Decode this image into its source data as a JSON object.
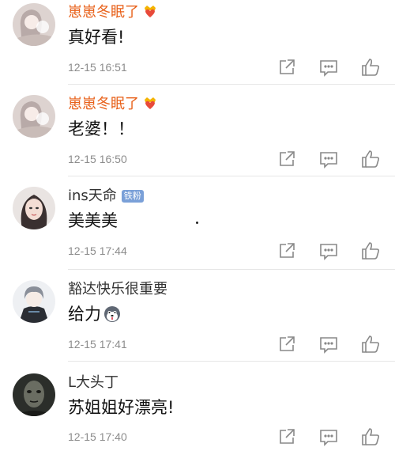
{
  "comments": [
    {
      "username": "崽崽冬眠了",
      "text": "真好看!",
      "time": "12-15 16:51",
      "badge": "crown-heart-icon",
      "avatar": "girl-sticker-avatar"
    },
    {
      "username": "崽崽冬眠了",
      "text": "老婆！！",
      "time": "12-15 16:50",
      "badge": "crown-heart-icon",
      "avatar": "girl-sticker-avatar"
    },
    {
      "username": "ins天命",
      "fan_badge": "铁粉",
      "text": "美美美",
      "time": "12-15 17:44",
      "avatar": "woman-portrait-avatar"
    },
    {
      "username": "豁达快乐很重要",
      "text": "给力",
      "emoji": "husky-dog-emoji",
      "time": "12-15 17:41",
      "avatar": "anime-boy-avatar"
    },
    {
      "username": "L大头丁",
      "text": "苏姐姐好漂亮!",
      "time": "12-15 17:40",
      "avatar": "dark-face-avatar"
    }
  ],
  "actions": [
    "share-icon",
    "comment-icon",
    "like-icon"
  ],
  "colors": {
    "vip_name": "#e8611a",
    "normal_name": "#333333",
    "time": "#8c8c8c",
    "icon": "#888888"
  }
}
